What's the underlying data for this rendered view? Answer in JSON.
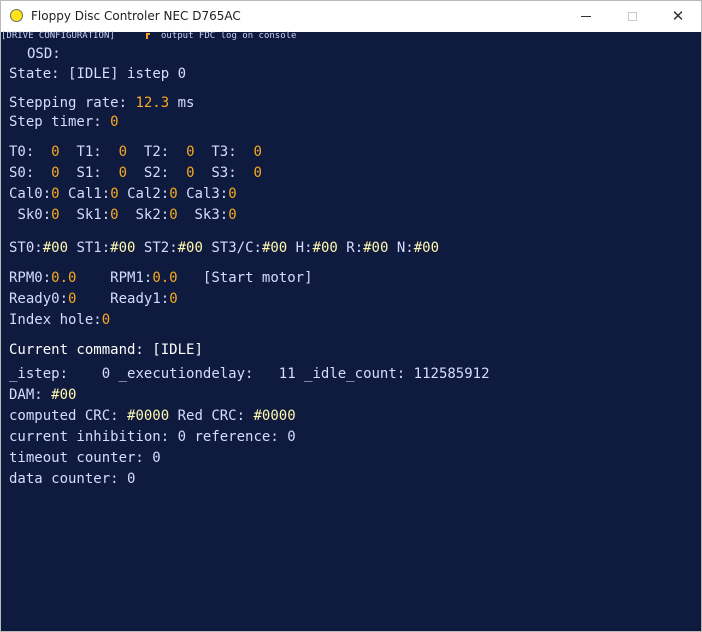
{
  "window": {
    "title": "Floppy Disc Controler NEC D765AC",
    "controls": {
      "minimize": "—",
      "maximize": "☐",
      "close": "✕"
    }
  },
  "menu": {
    "drive_configuration": "[DRIVE CONFIGURATION]",
    "log_toggle_label": "output FDC log on console"
  },
  "osd": {
    "label": "OSD:"
  },
  "state": {
    "label": "State:",
    "value": "[IDLE]",
    "istep_label": "istep",
    "istep_value": "0"
  },
  "stepping": {
    "rate_label": "Stepping rate:",
    "rate_value": "12.3",
    "rate_unit": "ms",
    "timer_label": "Step timer:",
    "timer_value": "0"
  },
  "drives": {
    "t": [
      {
        "label": "T0:",
        "value": "0"
      },
      {
        "label": "T1:",
        "value": "0"
      },
      {
        "label": "T2:",
        "value": "0"
      },
      {
        "label": "T3:",
        "value": "0"
      }
    ],
    "s": [
      {
        "label": "S0:",
        "value": "0"
      },
      {
        "label": "S1:",
        "value": "0"
      },
      {
        "label": "S2:",
        "value": "0"
      },
      {
        "label": "S3:",
        "value": "0"
      }
    ],
    "cal": [
      {
        "label": "Cal0:",
        "value": "0"
      },
      {
        "label": "Cal1:",
        "value": "0"
      },
      {
        "label": "Cal2:",
        "value": "0"
      },
      {
        "label": "Cal3:",
        "value": "0"
      }
    ],
    "sk": [
      {
        "label": "Sk0:",
        "value": "0"
      },
      {
        "label": "Sk1:",
        "value": "0"
      },
      {
        "label": "Sk2:",
        "value": "0"
      },
      {
        "label": "Sk3:",
        "value": "0"
      }
    ]
  },
  "status_regs": [
    {
      "label": "ST0:",
      "value": "#00"
    },
    {
      "label": "ST1:",
      "value": "#00"
    },
    {
      "label": "ST2:",
      "value": "#00"
    },
    {
      "label": "ST3/C:",
      "value": "#00"
    },
    {
      "label": "H:",
      "value": "#00"
    },
    {
      "label": "R:",
      "value": "#00"
    },
    {
      "label": "N:",
      "value": "#00"
    }
  ],
  "motor": {
    "rpm0_label": "RPM0:",
    "rpm0_value": "0.0",
    "rpm1_label": "RPM1:",
    "rpm1_value": "0.0",
    "start_motor": "[Start motor]",
    "ready0_label": "Ready0:",
    "ready0_value": "0",
    "ready1_label": "Ready1:",
    "ready1_value": "0",
    "index_label": "Index hole:",
    "index_value": "0"
  },
  "command": {
    "label": "Current command:",
    "value": "[IDLE]",
    "istep_label": "_istep:",
    "istep_value": "0",
    "exec_label": "_executiondelay:",
    "exec_value": "11",
    "idle_label": "_idle_count:",
    "idle_value": "112585912",
    "dam_label": "DAM:",
    "dam_value": "#00",
    "crc_label": "computed CRC:",
    "crc_value": "#0000",
    "red_crc_label": "Red CRC:",
    "red_crc_value": "#0000",
    "inhibition_label": "current inhibition:",
    "inhibition_value": "0",
    "reference_label": "reference:",
    "reference_value": "0",
    "timeout_label": "timeout counter:",
    "timeout_value": "0",
    "data_counter_label": "data counter:",
    "data_counter_value": "0"
  }
}
